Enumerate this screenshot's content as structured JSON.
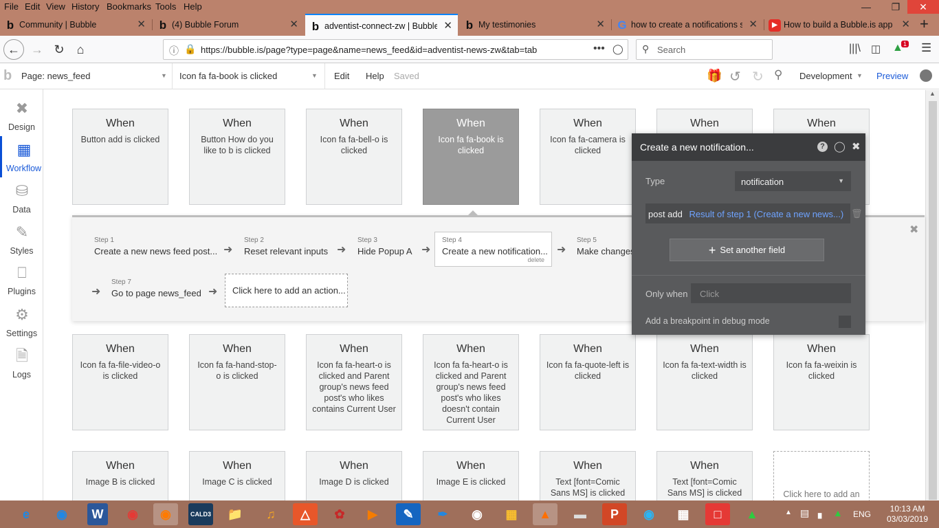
{
  "menubar": {
    "items": [
      "File",
      "Edit",
      "View",
      "History",
      "Bookmarks",
      "Tools",
      "Help"
    ]
  },
  "tabs": [
    {
      "title": "Community | Bubble",
      "icon": "b"
    },
    {
      "title": "(4) Bubble Forum",
      "icon": "b"
    },
    {
      "title": "adventist-connect-zw | Bubble",
      "icon": "b"
    },
    {
      "title": "My testimonies",
      "icon": "b"
    },
    {
      "title": "how to create a notifications sy",
      "icon": "G"
    },
    {
      "title": "How to build a Bubble.is app -",
      "icon": "▶"
    }
  ],
  "nav": {
    "url": "https://bubble.is/page?type=page&name=news_feed&id=adventist-news-zw&tab=tab",
    "search_placeholder": "Search",
    "badge": "1"
  },
  "editor": {
    "page_label": "Page: news_feed",
    "event_label": "Icon fa fa-book is clicked",
    "edit": "Edit",
    "help": "Help",
    "saved": "Saved",
    "mode": "Development",
    "preview": "Preview"
  },
  "sidebar": {
    "items": [
      "Design",
      "Workflow",
      "Data",
      "Styles",
      "Plugins",
      "Settings",
      "Logs"
    ]
  },
  "cards": {
    "when": "When",
    "row1": [
      "Button add is clicked",
      "Button How do you like to b is clicked",
      "Icon fa fa-bell-o is clicked",
      "Icon fa fa-book is clicked",
      "Icon fa fa-camera is clicked",
      "",
      ""
    ],
    "row2": [
      "Icon fa fa-file-video-o is clicked",
      "Icon fa fa-hand-stop-o is clicked",
      "Icon fa fa-heart-o is clicked and Parent group's news feed post's who likes contains Current User",
      "Icon fa fa-heart-o is clicked and Parent group's news feed post's who likes doesn't contain Current User",
      "Icon fa fa-quote-left is clicked",
      "Icon fa fa-text-width is clicked",
      "Icon fa fa-weixin is clicked"
    ],
    "row3": [
      "Image B is clicked",
      "Image C is clicked",
      "Image D is clicked",
      "Image E is clicked",
      "Text [font=Comic Sans MS] is clicked",
      "Text [font=Comic Sans MS] is clicked"
    ],
    "add": "Click here to add an"
  },
  "steps": [
    {
      "num": "Step 1",
      "text": "Create a new news feed post..."
    },
    {
      "num": "Step 2",
      "text": "Reset relevant inputs"
    },
    {
      "num": "Step 3",
      "text": "Hide Popup A"
    },
    {
      "num": "Step 4",
      "text": "Create a new notification...",
      "delete": "delete"
    },
    {
      "num": "Step 5",
      "text": "Make changes"
    },
    {
      "num": "Step 7",
      "text": "Go to page news_feed"
    }
  ],
  "add_action": "Click here to add an action...",
  "popup": {
    "title": "Create a new notification...",
    "type_label": "Type",
    "type_value": "notification",
    "field_name": "post add",
    "field_value": "Result of step 1 (Create a new news...)",
    "set_another": "Set another field",
    "only_when_label": "Only when",
    "only_when_placeholder": "Click",
    "breakpoint": "Add a breakpoint in debug mode"
  },
  "taskbar": {
    "time": "10:13 AM",
    "date": "03/03/2019",
    "lang": "ENG",
    "cald": "CALD3"
  },
  "colors": {
    "menubar": "#bb826c",
    "accent": "#1a5ad8",
    "popup": "#595a5c",
    "selected_card": "#9b9b9b"
  }
}
